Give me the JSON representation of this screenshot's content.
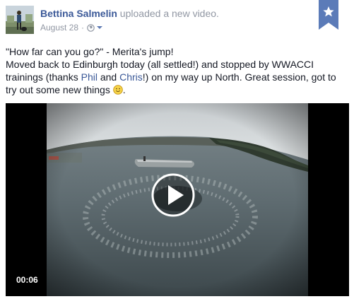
{
  "header": {
    "author": "Bettina Salmelin",
    "action": " uploaded a new video.",
    "date": "August 28",
    "separator": "·"
  },
  "icons": {
    "avatar": "profile-photo",
    "privacy": "globe-icon",
    "privacy_menu": "chevron-down-icon",
    "bookmark": "star-bookmark-icon",
    "emoji": "smiley-icon",
    "play": "play-icon"
  },
  "message": {
    "line1": "\"How far can you go?\" - Merita's jump!",
    "part1": "Moved back to Edinburgh today (all settled!) and stopped by WWACCI trainings (thanks ",
    "link1": "Phil",
    "part2": " and ",
    "link2": "Chris",
    "part3": "!) on my way up North. Great session, got to try out some new things ",
    "part4": "."
  },
  "video": {
    "duration": "00:06"
  },
  "colors": {
    "link": "#3b5998",
    "muted": "#9197a3",
    "text": "#141823",
    "bookmark": "#5b7bb8"
  }
}
